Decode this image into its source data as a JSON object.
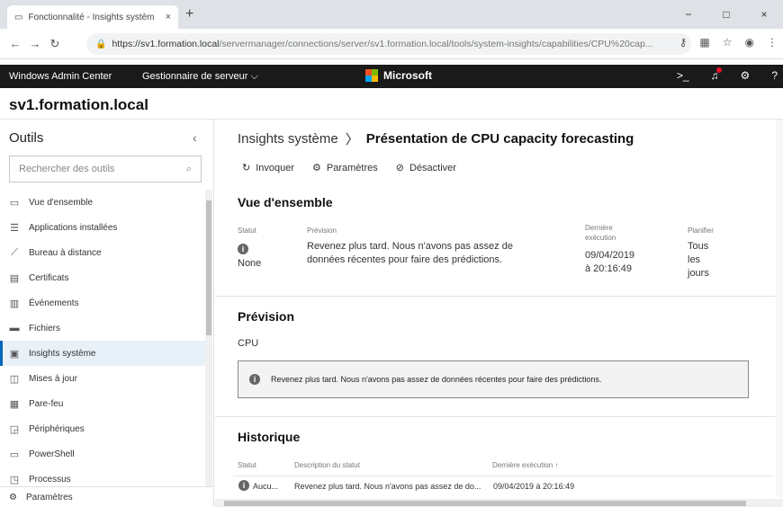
{
  "browser": {
    "tab_title": "Fonctionnalité - Insights systèm",
    "tab_close": "×",
    "new_tab": "+",
    "url_main": "https://sv1.formation.local",
    "url_path": "/servermanager/connections/server/sv1.formation.local/tools/system-insights/capabilities/CPU%20cap...",
    "window_controls": [
      "−",
      "□",
      "×"
    ]
  },
  "header": {
    "app_name": "Windows Admin Center",
    "server_manager": "Gestionnaire de serveur ⌵",
    "brand": "Microsoft",
    "brand_colors": [
      "#f25022",
      "#7fba00",
      "#00a4ef",
      "#ffb900"
    ]
  },
  "server_name": "sv1.formation.local",
  "sidebar": {
    "title": "Outils",
    "search_placeholder": "Rechercher des outils",
    "items": [
      {
        "label": "Vue d'ensemble",
        "icon": "server-icon"
      },
      {
        "label": "Applications installées",
        "icon": "list-icon"
      },
      {
        "label": "Bureau à distance",
        "icon": "remote-icon"
      },
      {
        "label": "Certificats",
        "icon": "certificate-icon"
      },
      {
        "label": "Événements",
        "icon": "event-icon"
      },
      {
        "label": "Fichiers",
        "icon": "folder-icon"
      },
      {
        "label": "Insights système",
        "icon": "insights-icon",
        "active": true
      },
      {
        "label": "Mises à jour",
        "icon": "update-icon"
      },
      {
        "label": "Pare-feu",
        "icon": "firewall-icon"
      },
      {
        "label": "Périphériques",
        "icon": "devices-icon"
      },
      {
        "label": "PowerShell",
        "icon": "powershell-icon"
      },
      {
        "label": "Processus",
        "icon": "process-icon"
      }
    ],
    "footer": "Paramètres"
  },
  "main": {
    "breadcrumb_parent": "Insights système",
    "breadcrumb_current": "Présentation de CPU capacity forecasting",
    "actions": {
      "invoke": "Invoquer",
      "settings": "Paramètres",
      "disable": "Désactiver"
    },
    "overview": {
      "title": "Vue d'ensemble",
      "status_label": "Statut",
      "status_value": "None",
      "prediction_label": "Prévision",
      "prediction_line1": "Revenez plus tard. Nous n'avons pas assez de",
      "prediction_line2": "données récentes pour faire des prédictions.",
      "last_run_label1": "Dernière",
      "last_run_label2": "exécution",
      "last_run_date": "09/04/2019",
      "last_run_time": "à 20:16:49",
      "schedule_label": "Planifier",
      "schedule_1": "Tous",
      "schedule_2": "les",
      "schedule_3": "jours"
    },
    "forecast": {
      "title": "Prévision",
      "resource": "CPU",
      "message": "Revenez plus tard. Nous n'avons pas assez de données récentes pour faire des prédictions."
    },
    "history": {
      "title": "Historique",
      "col_status": "Statut",
      "col_description": "Description du statut",
      "col_last_run": "Dernière exécution ↑",
      "row_status": "Aucu...",
      "row_description": "Revenez plus tard. Nous n'avons pas assez de do...",
      "row_last_run": "09/04/2019 à 20:16:49"
    }
  }
}
